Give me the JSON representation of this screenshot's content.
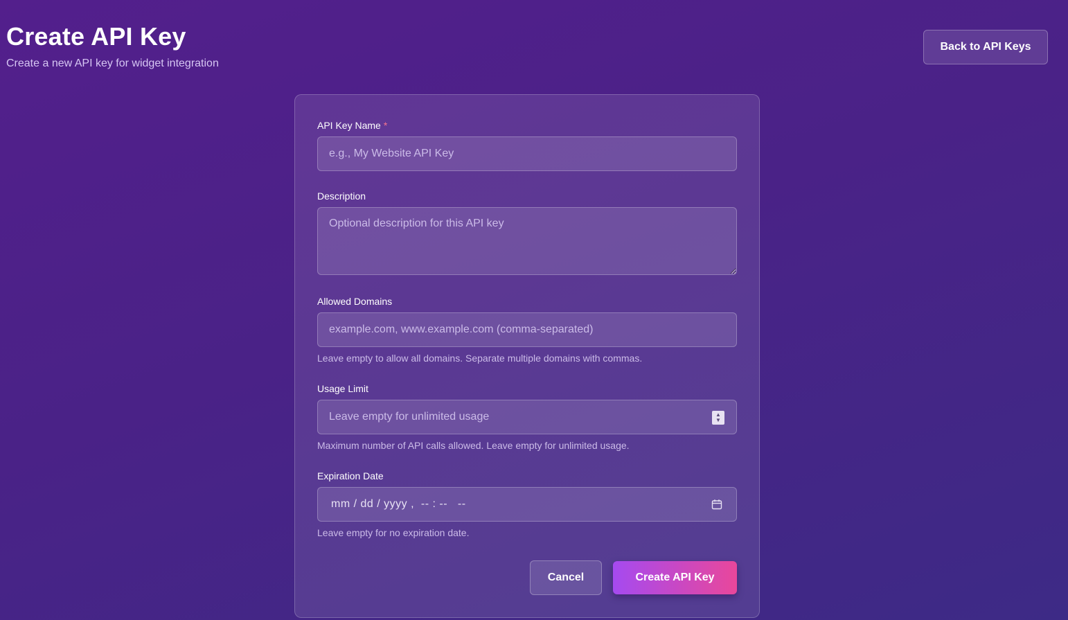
{
  "header": {
    "title": "Create API Key",
    "subtitle": "Create a new API key for widget integration",
    "back_label": "Back to API Keys"
  },
  "form": {
    "name": {
      "label": "API Key Name",
      "required_mark": "*",
      "placeholder": "e.g., My Website API Key",
      "value": ""
    },
    "description": {
      "label": "Description",
      "placeholder": "Optional description for this API key",
      "value": ""
    },
    "domains": {
      "label": "Allowed Domains",
      "placeholder": "example.com, www.example.com (comma-separated)",
      "help": "Leave empty to allow all domains. Separate multiple domains with commas.",
      "value": ""
    },
    "usage_limit": {
      "label": "Usage Limit",
      "placeholder": "Leave empty for unlimited usage",
      "help": "Maximum number of API calls allowed. Leave empty for unlimited usage.",
      "value": ""
    },
    "expiration": {
      "label": "Expiration Date",
      "display": "mm / dd / yyyy ,  -- : --   --",
      "help": "Leave empty for no expiration date.",
      "icon": "calendar-icon"
    },
    "cancel_label": "Cancel",
    "submit_label": "Create API Key"
  },
  "colors": {
    "accent_start": "#a54af0",
    "accent_end": "#e9479b",
    "required": "#f7768e"
  }
}
